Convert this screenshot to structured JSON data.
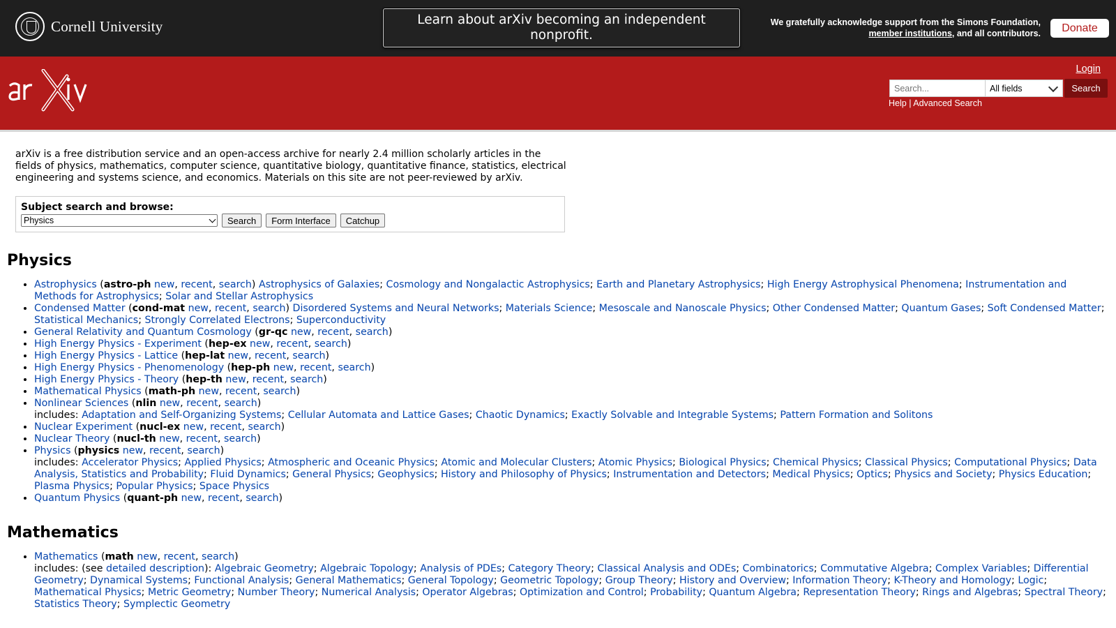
{
  "topbar": {
    "institution": "Cornell University",
    "banner": "Learn about arXiv becoming an independent nonprofit.",
    "ack_line1": "We gratefully acknowledge support from the Simons Foundation,",
    "ack_link": "member institutions",
    "ack_line2_rest": ", and all contributors.",
    "donate": "Donate"
  },
  "header": {
    "login": "Login",
    "search_placeholder": "Search...",
    "field_option": "All fields",
    "search_button": "Search",
    "help": "Help",
    "separator": "|",
    "advanced": "Advanced Search"
  },
  "intro": "arXiv is a free distribution service and an open-access archive for nearly 2.4 million scholarly articles in the fields of physics, mathematics, computer science, quantitative biology, quantitative finance, statistics, electrical engineering and systems science, and economics. Materials on this site are not peer-reviewed by arXiv.",
  "subject": {
    "label": "Subject search and browse:",
    "selected": "Physics",
    "search": "Search",
    "form": "Form Interface",
    "catchup": "Catchup"
  },
  "sections": {
    "physics": "Physics",
    "mathematics": "Mathematics"
  },
  "links": {
    "new": "new",
    "recent": "recent",
    "search": "search",
    "includes": "includes:",
    "see": "(see ",
    "detailed": "detailed description",
    "see_close": "):"
  },
  "physics": [
    {
      "name": "Astrophysics",
      "code": "astro-ph",
      "subs": [
        "Astrophysics of Galaxies",
        "Cosmology and Nongalactic Astrophysics",
        "Earth and Planetary Astrophysics",
        "High Energy Astrophysical Phenomena",
        "Instrumentation and Methods for Astrophysics",
        "Solar and Stellar Astrophysics"
      ]
    },
    {
      "name": "Condensed Matter",
      "code": "cond-mat",
      "subs": [
        "Disordered Systems and Neural Networks",
        "Materials Science",
        "Mesoscale and Nanoscale Physics",
        "Other Condensed Matter",
        "Quantum Gases",
        "Soft Condensed Matter",
        "Statistical Mechanics",
        "Strongly Correlated Electrons",
        "Superconductivity"
      ]
    },
    {
      "name": "General Relativity and Quantum Cosmology",
      "code": "gr-qc"
    },
    {
      "name": "High Energy Physics - Experiment",
      "code": "hep-ex"
    },
    {
      "name": "High Energy Physics - Lattice",
      "code": "hep-lat"
    },
    {
      "name": "High Energy Physics - Phenomenology",
      "code": "hep-ph"
    },
    {
      "name": "High Energy Physics - Theory",
      "code": "hep-th"
    },
    {
      "name": "Mathematical Physics",
      "code": "math-ph"
    },
    {
      "name": "Nonlinear Sciences",
      "code": "nlin",
      "includes": [
        "Adaptation and Self-Organizing Systems",
        "Cellular Automata and Lattice Gases",
        "Chaotic Dynamics",
        "Exactly Solvable and Integrable Systems",
        "Pattern Formation and Solitons"
      ]
    },
    {
      "name": "Nuclear Experiment",
      "code": "nucl-ex"
    },
    {
      "name": "Nuclear Theory",
      "code": "nucl-th"
    },
    {
      "name": "Physics",
      "code": "physics",
      "includes": [
        "Accelerator Physics",
        "Applied Physics",
        "Atmospheric and Oceanic Physics",
        "Atomic and Molecular Clusters",
        "Atomic Physics",
        "Biological Physics",
        "Chemical Physics",
        "Classical Physics",
        "Computational Physics",
        "Data Analysis, Statistics and Probability",
        "Fluid Dynamics",
        "General Physics",
        "Geophysics",
        "History and Philosophy of Physics",
        "Instrumentation and Detectors",
        "Medical Physics",
        "Optics",
        "Physics and Society",
        "Physics Education",
        "Plasma Physics",
        "Popular Physics",
        "Space Physics"
      ]
    },
    {
      "name": "Quantum Physics",
      "code": "quant-ph"
    }
  ],
  "mathematics": [
    {
      "name": "Mathematics",
      "code": "math",
      "see": true,
      "includes": [
        "Algebraic Geometry",
        "Algebraic Topology",
        "Analysis of PDEs",
        "Category Theory",
        "Classical Analysis and ODEs",
        "Combinatorics",
        "Commutative Algebra",
        "Complex Variables",
        "Differential Geometry",
        "Dynamical Systems",
        "Functional Analysis",
        "General Mathematics",
        "General Topology",
        "Geometric Topology",
        "Group Theory",
        "History and Overview",
        "Information Theory",
        "K-Theory and Homology",
        "Logic",
        "Mathematical Physics",
        "Metric Geometry",
        "Number Theory",
        "Numerical Analysis",
        "Operator Algebras",
        "Optimization and Control",
        "Probability",
        "Quantum Algebra",
        "Representation Theory",
        "Rings and Algebras",
        "Spectral Theory",
        "Statistics Theory",
        "Symplectic Geometry"
      ]
    }
  ]
}
